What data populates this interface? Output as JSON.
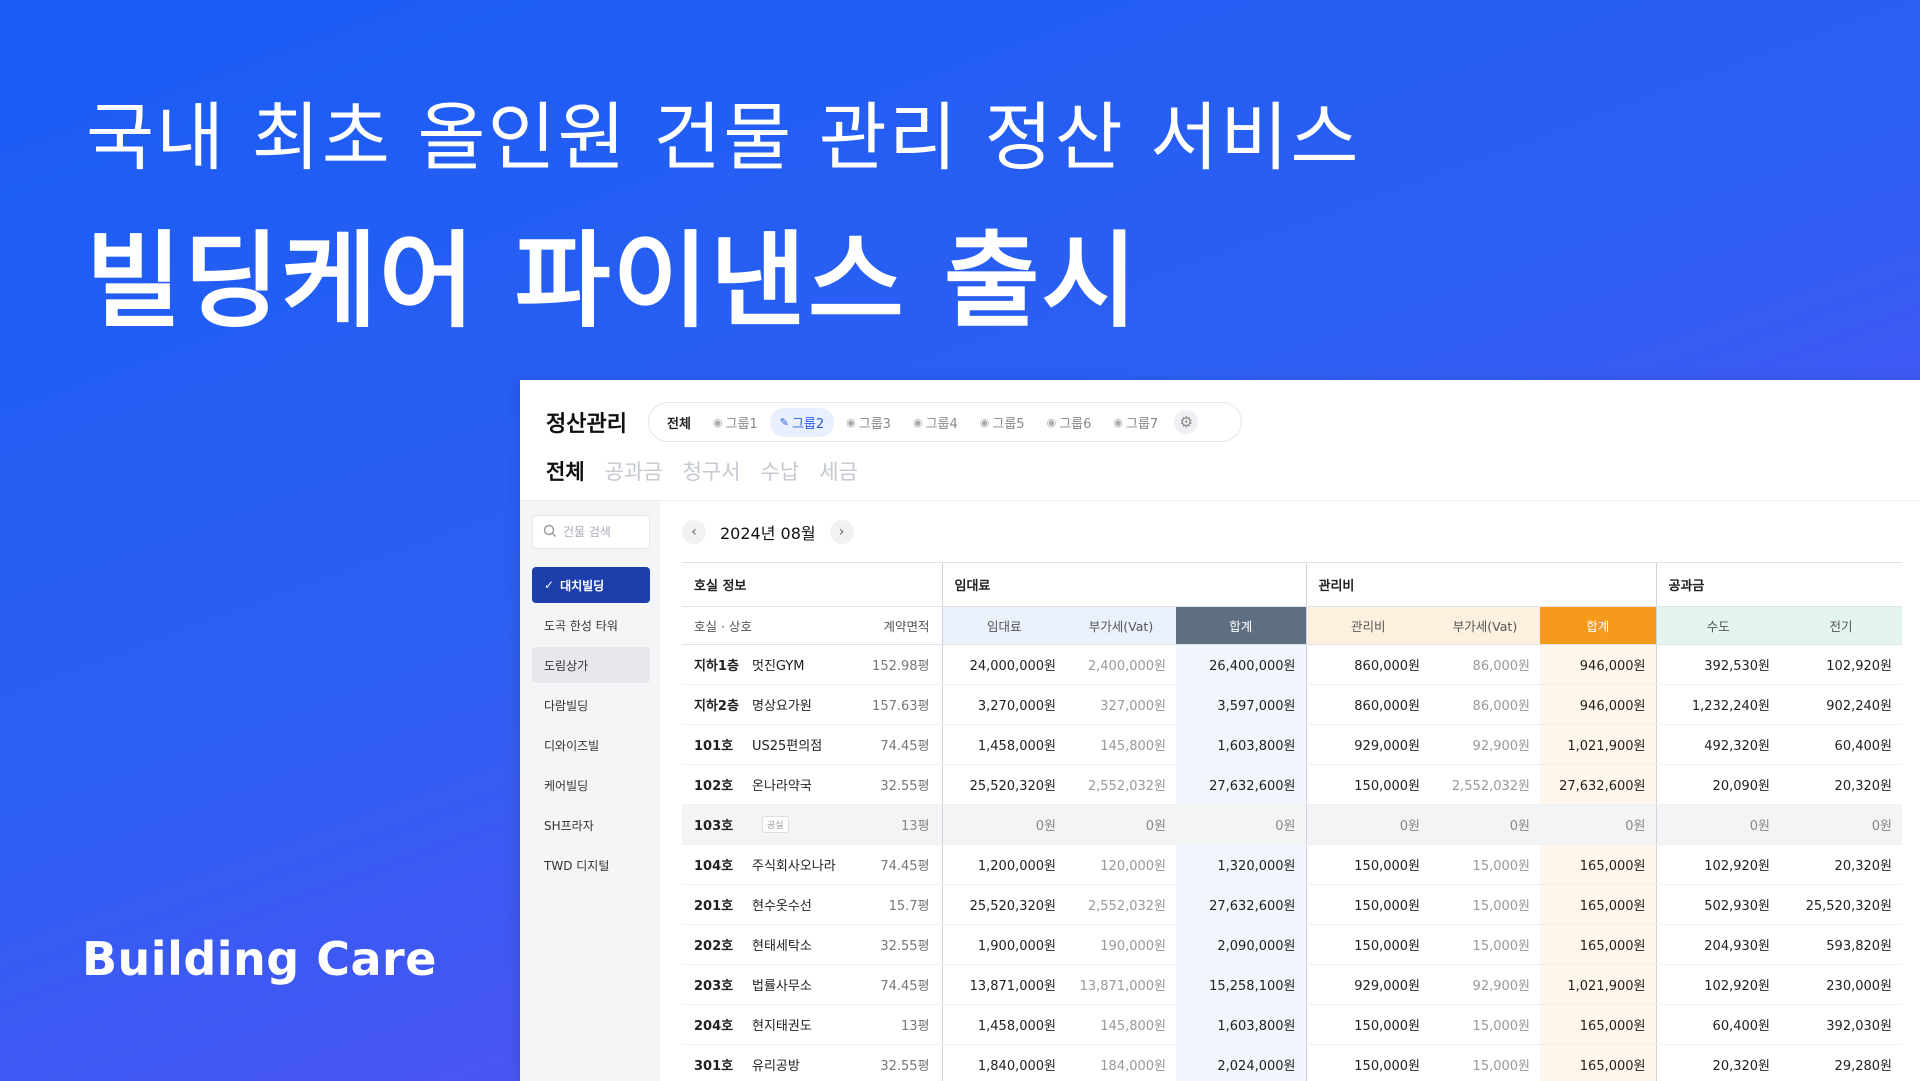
{
  "headline": {
    "line1": "국내 최초 올인원 건물 관리 정산 서비스",
    "line2": "빌딩케어 파이낸스 출시"
  },
  "brand": "Building Care",
  "app": {
    "title": "정산관리",
    "groups": [
      {
        "label": "전체",
        "icon": ""
      },
      {
        "label": "그룹1",
        "icon": "eye-icon"
      },
      {
        "label": "그룹2",
        "icon": "pencil-icon"
      },
      {
        "label": "그룹3",
        "icon": "eye-icon"
      },
      {
        "label": "그룹4",
        "icon": "eye-icon"
      },
      {
        "label": "그룹5",
        "icon": "eye-icon"
      },
      {
        "label": "그룹6",
        "icon": "eye-icon"
      },
      {
        "label": "그룹7",
        "icon": "eye-icon"
      }
    ],
    "tabs": [
      "전체",
      "공과금",
      "청구서",
      "수납",
      "세금"
    ],
    "search_placeholder": "건물 검색",
    "buildings": [
      "대치빌딩",
      "도곡 한성 타워",
      "도림상가",
      "다람빌딩",
      "디와이즈빌",
      "케어빌딩",
      "SH프라자",
      "TWD 디지털"
    ],
    "month": "2024년 08월",
    "group_headers": [
      "호실 정보",
      "임대료",
      "관리비",
      "공과금"
    ],
    "sub_headers": [
      "호실 · 상호",
      "계약면적",
      "임대료",
      "부가세(Vat)",
      "합계",
      "관리비",
      "부가세(Vat)",
      "합계",
      "수도",
      "전기"
    ],
    "vacant_badge": "공실",
    "rows": [
      [
        "지하1층",
        "멋진GYM",
        "152.98평",
        "24,000,000원",
        "2,400,000원",
        "26,400,000원",
        "860,000원",
        "86,000원",
        "946,000원",
        "392,530원",
        "102,920원"
      ],
      [
        "지하2층",
        "명상요가원",
        "157.63평",
        "3,270,000원",
        "327,000원",
        "3,597,000원",
        "860,000원",
        "86,000원",
        "946,000원",
        "1,232,240원",
        "902,240원"
      ],
      [
        "101호",
        "US25편의점",
        "74.45평",
        "1,458,000원",
        "145,800원",
        "1,603,800원",
        "929,000원",
        "92,900원",
        "1,021,900원",
        "492,320원",
        "60,400원"
      ],
      [
        "102호",
        "온나라약국",
        "32.55평",
        "25,520,320원",
        "2,552,032원",
        "27,632,600원",
        "150,000원",
        "2,552,032원",
        "27,632,600원",
        "20,090원",
        "20,320원"
      ],
      [
        "103호",
        "",
        "13평",
        "0원",
        "0원",
        "0원",
        "0원",
        "0원",
        "0원",
        "0원",
        "0원"
      ],
      [
        "104호",
        "주식회사오나라",
        "74.45평",
        "1,200,000원",
        "120,000원",
        "1,320,000원",
        "150,000원",
        "15,000원",
        "165,000원",
        "102,920원",
        "20,320원"
      ],
      [
        "201호",
        "현수옷수선",
        "15.7평",
        "25,520,320원",
        "2,552,032원",
        "27,632,600원",
        "150,000원",
        "15,000원",
        "165,000원",
        "502,930원",
        "25,520,320원"
      ],
      [
        "202호",
        "현태세탁소",
        "32.55평",
        "1,900,000원",
        "190,000원",
        "2,090,000원",
        "150,000원",
        "15,000원",
        "165,000원",
        "204,930원",
        "593,820원"
      ],
      [
        "203호",
        "법률사무소",
        "74.45평",
        "13,871,000원",
        "13,871,000원",
        "15,258,100원",
        "929,000원",
        "92,900원",
        "1,021,900원",
        "102,920원",
        "230,000원"
      ],
      [
        "204호",
        "현지태권도",
        "13평",
        "1,458,000원",
        "145,800원",
        "1,603,800원",
        "150,000원",
        "15,000원",
        "165,000원",
        "60,400원",
        "392,030원"
      ],
      [
        "301호",
        "유리공방",
        "32.55평",
        "1,840,000원",
        "184,000원",
        "2,024,000원",
        "150,000원",
        "15,000원",
        "165,000원",
        "20,320원",
        "29,280원"
      ]
    ],
    "colors": {
      "rent_sum": "#5f6f82",
      "mgmt_sum": "#f59a1a",
      "selected": "#1c3faa"
    }
  }
}
